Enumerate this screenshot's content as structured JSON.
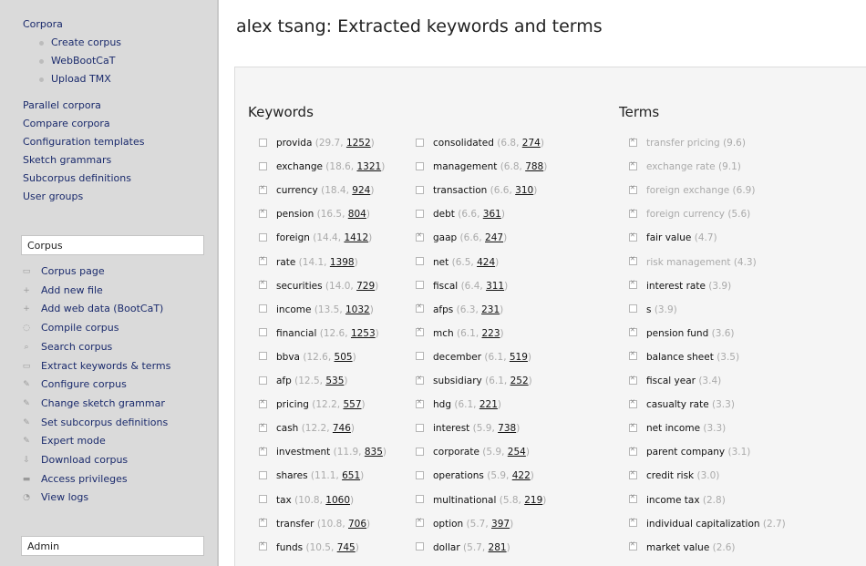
{
  "sidebar": {
    "nav": [
      {
        "label": "Corpora",
        "sub": false
      },
      {
        "label": "Create corpus",
        "sub": true
      },
      {
        "label": "WebBootCaT",
        "sub": true
      },
      {
        "label": "Upload TMX",
        "sub": true
      },
      {
        "label": "Parallel corpora",
        "sub": false
      },
      {
        "label": "Compare corpora",
        "sub": false
      },
      {
        "label": "Configuration templates",
        "sub": false
      },
      {
        "label": "Sketch grammars",
        "sub": false
      },
      {
        "label": "Subcorpus definitions",
        "sub": false
      },
      {
        "label": "User groups",
        "sub": false
      }
    ],
    "corpus_box": "Corpus",
    "tools": [
      {
        "label": "Corpus page",
        "icon": "page-icon"
      },
      {
        "label": "Add new file",
        "icon": "plus-icon"
      },
      {
        "label": "Add web data (BootCaT)",
        "icon": "plus-icon"
      },
      {
        "label": "Compile corpus",
        "icon": "gear-icon"
      },
      {
        "label": "Search corpus",
        "icon": "search-icon"
      },
      {
        "label": "Extract keywords & terms",
        "icon": "page-icon"
      },
      {
        "label": "Configure corpus",
        "icon": "wrench-icon"
      },
      {
        "label": "Change sketch grammar",
        "icon": "wrench-icon"
      },
      {
        "label": "Set subcorpus definitions",
        "icon": "wrench-icon"
      },
      {
        "label": "Expert mode",
        "icon": "wrench-icon"
      },
      {
        "label": "Download corpus",
        "icon": "download-icon"
      },
      {
        "label": "Access privileges",
        "icon": "lock-icon"
      },
      {
        "label": "View logs",
        "icon": "log-icon"
      }
    ],
    "admin_box": "Admin"
  },
  "header": {
    "title": "alex tsang: Extracted keywords and terms"
  },
  "keywords_heading": "Keywords",
  "terms_heading": "Terms",
  "keywords_col1": [
    {
      "word": "provida",
      "score": "29.7",
      "freq": "1252",
      "checked": false
    },
    {
      "word": "exchange",
      "score": "18.6",
      "freq": "1321",
      "checked": false
    },
    {
      "word": "currency",
      "score": "18.4",
      "freq": "924",
      "checked": true
    },
    {
      "word": "pension",
      "score": "16.5",
      "freq": "804",
      "checked": true
    },
    {
      "word": "foreign",
      "score": "14.4",
      "freq": "1412",
      "checked": false
    },
    {
      "word": "rate",
      "score": "14.1",
      "freq": "1398",
      "checked": true
    },
    {
      "word": "securities",
      "score": "14.0",
      "freq": "729",
      "checked": true
    },
    {
      "word": "income",
      "score": "13.5",
      "freq": "1032",
      "checked": false
    },
    {
      "word": "financial",
      "score": "12.6",
      "freq": "1253",
      "checked": false
    },
    {
      "word": "bbva",
      "score": "12.6",
      "freq": "505",
      "checked": false
    },
    {
      "word": "afp",
      "score": "12.5",
      "freq": "535",
      "checked": false
    },
    {
      "word": "pricing",
      "score": "12.2",
      "freq": "557",
      "checked": true
    },
    {
      "word": "cash",
      "score": "12.2",
      "freq": "746",
      "checked": true
    },
    {
      "word": "investment",
      "score": "11.9",
      "freq": "835",
      "checked": true
    },
    {
      "word": "shares",
      "score": "11.1",
      "freq": "651",
      "checked": false
    },
    {
      "word": "tax",
      "score": "10.8",
      "freq": "1060",
      "checked": false
    },
    {
      "word": "transfer",
      "score": "10.8",
      "freq": "706",
      "checked": true
    },
    {
      "word": "funds",
      "score": "10.5",
      "freq": "745",
      "checked": true
    }
  ],
  "keywords_col2": [
    {
      "word": "consolidated",
      "score": "6.8",
      "freq": "274",
      "checked": false
    },
    {
      "word": "management",
      "score": "6.8",
      "freq": "788",
      "checked": false
    },
    {
      "word": "transaction",
      "score": "6.6",
      "freq": "310",
      "checked": false
    },
    {
      "word": "debt",
      "score": "6.6",
      "freq": "361",
      "checked": false
    },
    {
      "word": "gaap",
      "score": "6.6",
      "freq": "247",
      "checked": true
    },
    {
      "word": "net",
      "score": "6.5",
      "freq": "424",
      "checked": false
    },
    {
      "word": "fiscal",
      "score": "6.4",
      "freq": "311",
      "checked": false
    },
    {
      "word": "afps",
      "score": "6.3",
      "freq": "231",
      "checked": true
    },
    {
      "word": "mch",
      "score": "6.1",
      "freq": "223",
      "checked": true
    },
    {
      "word": "december",
      "score": "6.1",
      "freq": "519",
      "checked": false
    },
    {
      "word": "subsidiary",
      "score": "6.1",
      "freq": "252",
      "checked": true
    },
    {
      "word": "hdg",
      "score": "6.1",
      "freq": "221",
      "checked": true
    },
    {
      "word": "interest",
      "score": "5.9",
      "freq": "738",
      "checked": false
    },
    {
      "word": "corporate",
      "score": "5.9",
      "freq": "254",
      "checked": false
    },
    {
      "word": "operations",
      "score": "5.9",
      "freq": "422",
      "checked": false
    },
    {
      "word": "multinational",
      "score": "5.8",
      "freq": "219",
      "checked": false
    },
    {
      "word": "option",
      "score": "5.7",
      "freq": "397",
      "checked": true
    },
    {
      "word": "dollar",
      "score": "5.7",
      "freq": "281",
      "checked": false
    }
  ],
  "terms": [
    {
      "term": "transfer pricing",
      "score": "(9.6)",
      "checked": true,
      "dim": true
    },
    {
      "term": "exchange rate",
      "score": "(9.1)",
      "checked": true,
      "dim": true
    },
    {
      "term": "foreign exchange",
      "score": "(6.9)",
      "checked": true,
      "dim": true
    },
    {
      "term": "foreign currency",
      "score": "(5.6)",
      "checked": true,
      "dim": true
    },
    {
      "term": "fair value",
      "score": "(4.7)",
      "checked": true,
      "dim": false
    },
    {
      "term": "risk management",
      "score": "(4.3)",
      "checked": true,
      "dim": true
    },
    {
      "term": "interest rate",
      "score": "(3.9)",
      "checked": true,
      "dim": false
    },
    {
      "term": "s",
      "score": "(3.9)",
      "checked": false,
      "dim": false
    },
    {
      "term": "pension fund",
      "score": "(3.6)",
      "checked": true,
      "dim": false
    },
    {
      "term": "balance sheet",
      "score": "(3.5)",
      "checked": true,
      "dim": false
    },
    {
      "term": "fiscal year",
      "score": "(3.4)",
      "checked": true,
      "dim": false
    },
    {
      "term": "casualty rate",
      "score": "(3.3)",
      "checked": true,
      "dim": false
    },
    {
      "term": "net income",
      "score": "(3.3)",
      "checked": true,
      "dim": false
    },
    {
      "term": "parent company",
      "score": "(3.1)",
      "checked": true,
      "dim": false
    },
    {
      "term": "credit risk",
      "score": "(3.0)",
      "checked": true,
      "dim": false
    },
    {
      "term": "income tax",
      "score": "(2.8)",
      "checked": true,
      "dim": false
    },
    {
      "term": "individual capitalization",
      "score": "(2.7)",
      "checked": true,
      "dim": false
    },
    {
      "term": "market value",
      "score": "(2.6)",
      "checked": true,
      "dim": false
    }
  ]
}
